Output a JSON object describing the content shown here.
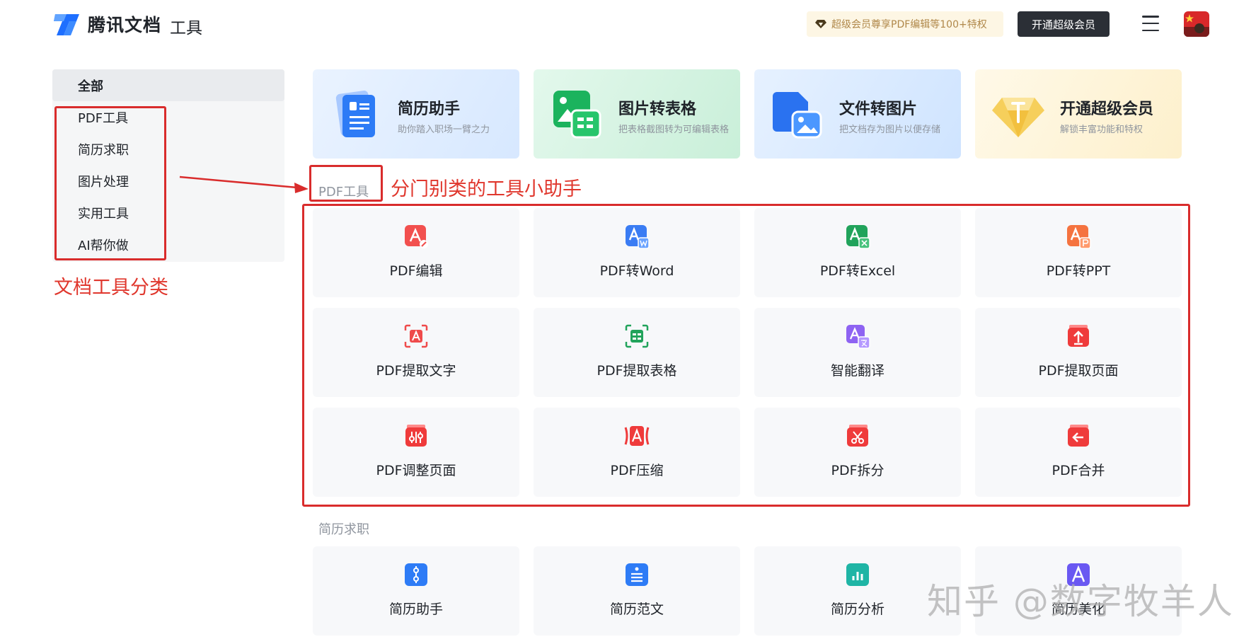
{
  "header": {
    "app_name": "腾讯文档",
    "app_sub": "工具",
    "promo_text": "超级会员尊享PDF编辑等100+特权",
    "vip_button": "开通超级会员",
    "menu_icon": "hamburger-menu-icon",
    "avatar_icon": "user-avatar"
  },
  "sidebar": {
    "items": [
      {
        "label": "全部",
        "active": true
      },
      {
        "label": "PDF工具"
      },
      {
        "label": "简历求职"
      },
      {
        "label": "图片处理"
      },
      {
        "label": "实用工具"
      },
      {
        "label": "AI帮你做"
      }
    ]
  },
  "annotations": {
    "category_label": "文档工具分类",
    "section_label": "分门别类的工具小助手",
    "color": "#d92c2c"
  },
  "banners": [
    {
      "title": "简历助手",
      "subtitle": "助你踏入职场一臂之力",
      "icon": "resume-document-icon"
    },
    {
      "title": "图片转表格",
      "subtitle": "把表格截图转为可编辑表格",
      "icon": "image-to-table-icon"
    },
    {
      "title": "文件转图片",
      "subtitle": "把文档存为图片以便存储",
      "icon": "file-to-image-icon"
    },
    {
      "title": "开通超级会员",
      "subtitle": "解锁丰富功能和特权",
      "icon": "diamond-icon"
    }
  ],
  "sections": [
    {
      "title": "PDF工具",
      "tools": [
        {
          "label": "PDF编辑",
          "icon": "pdf-edit-icon",
          "color": "#f2504e"
        },
        {
          "label": "PDF转Word",
          "icon": "pdf-to-word-icon",
          "color": "#3a7cf3"
        },
        {
          "label": "PDF转Excel",
          "icon": "pdf-to-excel-icon",
          "color": "#21a35b"
        },
        {
          "label": "PDF转PPT",
          "icon": "pdf-to-ppt-icon",
          "color": "#f5733f"
        },
        {
          "label": "PDF提取文字",
          "icon": "pdf-extract-text-icon",
          "color": "#ef4b4b"
        },
        {
          "label": "PDF提取表格",
          "icon": "pdf-extract-table-icon",
          "color": "#21a35b"
        },
        {
          "label": "智能翻译",
          "icon": "translate-icon",
          "color": "#8e63f2"
        },
        {
          "label": "PDF提取页面",
          "icon": "pdf-extract-page-icon",
          "color": "#ef3b3b"
        },
        {
          "label": "PDF调整页面",
          "icon": "pdf-adjust-page-icon",
          "color": "#ef3b3b"
        },
        {
          "label": "PDF压缩",
          "icon": "pdf-compress-icon",
          "color": "#ef3b3b"
        },
        {
          "label": "PDF拆分",
          "icon": "pdf-split-icon",
          "color": "#ef3b3b"
        },
        {
          "label": "PDF合并",
          "icon": "pdf-merge-icon",
          "color": "#ef3b3b"
        }
      ]
    },
    {
      "title": "简历求职",
      "tools": [
        {
          "label": "简历助手",
          "icon": "resume-assistant-icon",
          "color": "#2e7cf6"
        },
        {
          "label": "简历范文",
          "icon": "resume-template-icon",
          "color": "#2e7cf6"
        },
        {
          "label": "简历分析",
          "icon": "resume-analysis-icon",
          "color": "#1fb5a5"
        },
        {
          "label": "简历美化",
          "icon": "resume-beautify-icon",
          "color": "#6a58f2"
        }
      ]
    }
  ],
  "watermark": "知乎 @数字牧羊人"
}
